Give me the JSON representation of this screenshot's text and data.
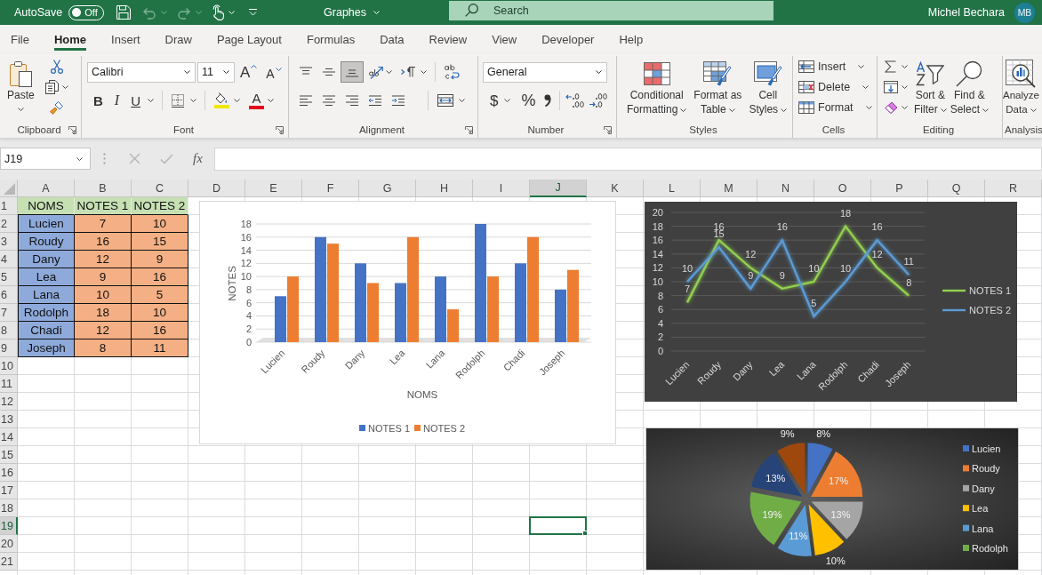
{
  "title_bar": {
    "autosave": {
      "label": "AutoSave",
      "on": false,
      "state_label": "Off"
    },
    "undo": {
      "disabled": true
    },
    "redo": {
      "disabled": true
    },
    "document_title": "Graphes",
    "search": {
      "placeholder": "Search"
    },
    "user": {
      "name": "Michel Bechara",
      "initials": "MB"
    }
  },
  "tabs": [
    {
      "label": "File",
      "selected": false
    },
    {
      "label": "Home",
      "selected": true
    },
    {
      "label": "Insert",
      "selected": false
    },
    {
      "label": "Draw",
      "selected": false
    },
    {
      "label": "Page Layout",
      "selected": false
    },
    {
      "label": "Formulas",
      "selected": false
    },
    {
      "label": "Data",
      "selected": false
    },
    {
      "label": "Review",
      "selected": false
    },
    {
      "label": "View",
      "selected": false
    },
    {
      "label": "Developer",
      "selected": false
    },
    {
      "label": "Help",
      "selected": false
    }
  ],
  "ribbon": {
    "groups": [
      {
        "kind": "clipboard",
        "label": "Clipboard",
        "launcher": true,
        "paste": "Paste"
      },
      {
        "kind": "font",
        "label": "Font",
        "launcher": true,
        "font_name": "Calibri",
        "font_size": "11",
        "grow_font": "A",
        "shrink_font": "A",
        "bold": "B",
        "italic": "I",
        "underline": "U",
        "font_color": "A"
      },
      {
        "kind": "alignment",
        "label": "Alignment",
        "launcher": true,
        "vertical_align": [
          {
            "kind": "top",
            "selected": false
          },
          {
            "kind": "middle",
            "selected": false
          },
          {
            "kind": "bottom",
            "selected": true
          }
        ]
      },
      {
        "kind": "number",
        "label": "Number",
        "launcher": true,
        "format": "General",
        "currency": "$",
        "percent": "%"
      },
      {
        "kind": "styles",
        "label": "Styles",
        "launcher": false,
        "buttons": [
          {
            "kind": "conditional",
            "lines": [
              "Conditional",
              "Formatting"
            ]
          },
          {
            "kind": "table",
            "lines": [
              "Format as",
              "Table"
            ]
          },
          {
            "kind": "cell_styles",
            "lines": [
              "Cell",
              "Styles"
            ]
          }
        ]
      },
      {
        "kind": "cells",
        "label": "Cells",
        "launcher": false,
        "buttons": [
          {
            "kind": "insert",
            "label": "Insert"
          },
          {
            "kind": "delete",
            "label": "Delete"
          },
          {
            "kind": "format",
            "label": "Format"
          }
        ]
      },
      {
        "kind": "editing",
        "label": "Editing",
        "launcher": false,
        "buttons": [
          {
            "kind": "sort",
            "lines": [
              "Sort &",
              "Filter"
            ]
          },
          {
            "kind": "find",
            "lines": [
              "Find &",
              "Select"
            ]
          }
        ]
      },
      {
        "kind": "analysis",
        "label": "Analysis",
        "launcher": false,
        "buttons": [
          {
            "kind": "analyze",
            "lines": [
              "Analyze",
              "Data"
            ]
          }
        ]
      }
    ]
  },
  "formula_bar": {
    "name_box": "J19",
    "cancel": {
      "disabled": true
    },
    "enter": {
      "disabled": true
    },
    "insert_function": "fx"
  },
  "sheet": {
    "columns": [
      {
        "label": "A",
        "selected": false
      },
      {
        "label": "B",
        "selected": false
      },
      {
        "label": "C",
        "selected": false
      },
      {
        "label": "D",
        "selected": false
      },
      {
        "label": "E",
        "selected": false
      },
      {
        "label": "F",
        "selected": false
      },
      {
        "label": "G",
        "selected": false
      },
      {
        "label": "H",
        "selected": false
      },
      {
        "label": "I",
        "selected": false
      },
      {
        "label": "J",
        "selected": true
      },
      {
        "label": "K",
        "selected": false
      },
      {
        "label": "L",
        "selected": false
      },
      {
        "label": "M",
        "selected": false
      },
      {
        "label": "N",
        "selected": false
      },
      {
        "label": "O",
        "selected": false
      },
      {
        "label": "P",
        "selected": false
      },
      {
        "label": "Q",
        "selected": false
      },
      {
        "label": "R",
        "selected": false
      }
    ],
    "rows": [
      {
        "label": "1",
        "selected": false
      },
      {
        "label": "2",
        "selected": false
      },
      {
        "label": "3",
        "selected": false
      },
      {
        "label": "4",
        "selected": false
      },
      {
        "label": "5",
        "selected": false
      },
      {
        "label": "6",
        "selected": false
      },
      {
        "label": "7",
        "selected": false
      },
      {
        "label": "8",
        "selected": false
      },
      {
        "label": "9",
        "selected": false
      },
      {
        "label": "10",
        "selected": false
      },
      {
        "label": "11",
        "selected": false
      },
      {
        "label": "12",
        "selected": false
      },
      {
        "label": "13",
        "selected": false
      },
      {
        "label": "14",
        "selected": false
      },
      {
        "label": "15",
        "selected": false
      },
      {
        "label": "16",
        "selected": false
      },
      {
        "label": "17",
        "selected": false
      },
      {
        "label": "18",
        "selected": false
      },
      {
        "label": "19",
        "selected": true
      },
      {
        "label": "20",
        "selected": false
      },
      {
        "label": "21",
        "selected": false
      }
    ],
    "table": {
      "header": [
        "NOMS",
        "NOTES 1",
        "NOTES 2"
      ],
      "rows": [
        [
          "Lucien",
          "7",
          "10"
        ],
        [
          "Roudy",
          "16",
          "15"
        ],
        [
          "Dany",
          "12",
          "9"
        ],
        [
          "Lea",
          "9",
          "16"
        ],
        [
          "Lana",
          "10",
          "5"
        ],
        [
          "Rodolph",
          "18",
          "10"
        ],
        [
          "Chadi",
          "12",
          "16"
        ],
        [
          "Joseph",
          "8",
          "11"
        ]
      ]
    }
  },
  "bar_chart": {
    "chart_data": {
      "type": "bar",
      "xlabel": "NOMS",
      "ylabel": "NOTES",
      "categories": [
        "Lucien",
        "Roudy",
        "Dany",
        "Lea",
        "Lana",
        "Rodolph",
        "Chadi",
        "Joseph"
      ],
      "series": [
        {
          "name": "NOTES 1",
          "color": "#4472c4",
          "values": [
            7,
            16,
            12,
            9,
            10,
            18,
            12,
            8
          ]
        },
        {
          "name": "NOTES 2",
          "color": "#ed7d31",
          "values": [
            10,
            15,
            9,
            16,
            5,
            10,
            16,
            11
          ]
        }
      ],
      "ylim": [
        0,
        18
      ],
      "yticks": [
        0,
        2,
        4,
        6,
        8,
        10,
        12,
        14,
        16,
        18
      ],
      "grid": true,
      "legend": "bottom"
    }
  },
  "line_chart": {
    "chart_data": {
      "type": "line",
      "categories": [
        "Lucien",
        "Roudy",
        "Dany",
        "Lea",
        "Lana",
        "Rodolph",
        "Chadi",
        "Joseph"
      ],
      "series": [
        {
          "name": "NOTES 1",
          "color": "#92d050",
          "values": [
            7,
            16,
            12,
            9,
            10,
            18,
            12,
            8
          ]
        },
        {
          "name": "NOTES 2",
          "color": "#5b9bd5",
          "values": [
            10,
            15,
            9,
            16,
            5,
            10,
            16,
            11
          ]
        }
      ],
      "ylim": [
        0,
        20
      ],
      "yticks": [
        0,
        2,
        4,
        6,
        8,
        10,
        12,
        14,
        16,
        18,
        20
      ],
      "data_labels": true,
      "grid": true,
      "legend": "right"
    }
  },
  "pie_chart": {
    "chart_data": {
      "type": "pie",
      "values": [
        8,
        17,
        13,
        10,
        11,
        19,
        13,
        9
      ],
      "value_labels": [
        "8%",
        "17%",
        "13%",
        "10%",
        "11%",
        "19%",
        "13%",
        "9%"
      ]
    },
    "slices": [
      {
        "color": "#4472c4"
      },
      {
        "color": "#ed7d31"
      },
      {
        "color": "#a5a5a5"
      },
      {
        "color": "#ffc000"
      },
      {
        "color": "#5b9bd5"
      },
      {
        "color": "#70ad47"
      },
      {
        "color": "#264478"
      },
      {
        "color": "#9e480e"
      }
    ],
    "legend": [
      {
        "label": "Lucien",
        "color": "#4472c4"
      },
      {
        "label": "Roudy",
        "color": "#ed7d31"
      },
      {
        "label": "Dany",
        "color": "#a5a5a5"
      },
      {
        "label": "Lea",
        "color": "#ffc000"
      },
      {
        "label": "Lana",
        "color": "#5b9bd5"
      },
      {
        "label": "Rodolph",
        "color": "#70ad47"
      }
    ]
  }
}
